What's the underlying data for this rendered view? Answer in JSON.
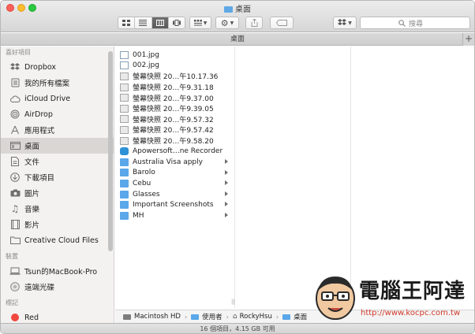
{
  "window": {
    "title": "桌面",
    "path_tab": "桌面",
    "new_tab_glyph": "+"
  },
  "toolbar": {
    "view_modes": [
      "icon-view",
      "list-view",
      "column-view",
      "cover-flow-view"
    ],
    "active_view": "column-view",
    "search_placeholder": "搜尋",
    "icons": [
      "arrange-icon",
      "gear-icon",
      "share-icon",
      "tag-icon",
      "dropbox-icon",
      "search-icon"
    ]
  },
  "sidebar": {
    "favorites_header": "喜好項目",
    "favorites": [
      {
        "label": "Dropbox",
        "icon": "dropbox-icon"
      },
      {
        "label": "我的所有檔案",
        "icon": "all-files-icon"
      },
      {
        "label": "iCloud Drive",
        "icon": "cloud-icon"
      },
      {
        "label": "AirDrop",
        "icon": "airdrop-icon"
      },
      {
        "label": "應用程式",
        "icon": "applications-icon"
      },
      {
        "label": "桌面",
        "icon": "desktop-icon",
        "selected": true
      },
      {
        "label": "文件",
        "icon": "documents-icon"
      },
      {
        "label": "下載項目",
        "icon": "downloads-icon"
      },
      {
        "label": "圖片",
        "icon": "pictures-icon"
      },
      {
        "label": "音樂",
        "icon": "music-icon"
      },
      {
        "label": "影片",
        "icon": "movies-icon"
      },
      {
        "label": "Creative Cloud Files",
        "icon": "folder-icon"
      }
    ],
    "devices_header": "裝置",
    "devices": [
      {
        "label": "Tsun的MacBook-Pro",
        "icon": "laptop-icon"
      },
      {
        "label": "遠端光碟",
        "icon": "disc-icon"
      }
    ],
    "tags_header": "標記",
    "tags": [
      {
        "label": "Red",
        "color": "#f0473f"
      }
    ]
  },
  "column1": {
    "items": [
      {
        "name": "001.jpg",
        "kind": "image",
        "has_children": false
      },
      {
        "name": "002.jpg",
        "kind": "image",
        "has_children": false
      },
      {
        "name": "螢幕快照 20…午10.17.36",
        "kind": "screenshot",
        "has_children": false
      },
      {
        "name": "螢幕快照 20…午9.31.18",
        "kind": "screenshot",
        "has_children": false
      },
      {
        "name": "螢幕快照 20…午9.37.00",
        "kind": "screenshot",
        "has_children": false
      },
      {
        "name": "螢幕快照 20…午9.39.05",
        "kind": "screenshot",
        "has_children": false
      },
      {
        "name": "螢幕快照 20…午9.57.32",
        "kind": "screenshot",
        "has_children": false
      },
      {
        "name": "螢幕快照 20…午9.57.42",
        "kind": "screenshot",
        "has_children": false
      },
      {
        "name": "螢幕快照 20…午9.58.20",
        "kind": "screenshot",
        "has_children": false
      },
      {
        "name": "Apowersoft…ne Recorder",
        "kind": "app",
        "has_children": false
      },
      {
        "name": "Australia Visa apply",
        "kind": "folder",
        "has_children": true
      },
      {
        "name": "Barolo",
        "kind": "folder",
        "has_children": true
      },
      {
        "name": "Cebu",
        "kind": "folder",
        "has_children": true
      },
      {
        "name": "Glasses",
        "kind": "folder",
        "has_children": true
      },
      {
        "name": "Important Screenshots",
        "kind": "folder",
        "has_children": true
      },
      {
        "name": "MH",
        "kind": "folder",
        "has_children": true
      }
    ]
  },
  "pathbar": {
    "segments": [
      {
        "label": "Macintosh HD",
        "icon": "hard-drive-icon"
      },
      {
        "label": "使用者",
        "icon": "folder-icon"
      },
      {
        "label": "RockyHsu",
        "icon": "home-icon"
      },
      {
        "label": "桌面",
        "icon": "folder-icon"
      }
    ],
    "separator": "›"
  },
  "status": {
    "text": "16 個項目，4.15 GB 可用"
  },
  "watermark": {
    "title": "電腦王阿達",
    "url": "http://www.kocpc.com.tw"
  },
  "colors": {
    "folder_blue": "#5aa7e9",
    "selected_sidebar": "#d9d6d4",
    "tag_red": "#f0473f"
  }
}
